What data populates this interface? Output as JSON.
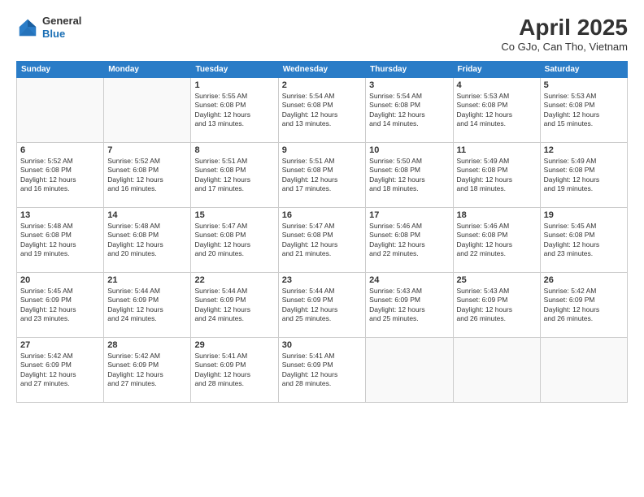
{
  "header": {
    "logo_general": "General",
    "logo_blue": "Blue",
    "month_year": "April 2025",
    "location": "Co GJo, Can Tho, Vietnam"
  },
  "days_of_week": [
    "Sunday",
    "Monday",
    "Tuesday",
    "Wednesday",
    "Thursday",
    "Friday",
    "Saturday"
  ],
  "weeks": [
    [
      {
        "day": "",
        "info": ""
      },
      {
        "day": "",
        "info": ""
      },
      {
        "day": "1",
        "info": "Sunrise: 5:55 AM\nSunset: 6:08 PM\nDaylight: 12 hours\nand 13 minutes."
      },
      {
        "day": "2",
        "info": "Sunrise: 5:54 AM\nSunset: 6:08 PM\nDaylight: 12 hours\nand 13 minutes."
      },
      {
        "day": "3",
        "info": "Sunrise: 5:54 AM\nSunset: 6:08 PM\nDaylight: 12 hours\nand 14 minutes."
      },
      {
        "day": "4",
        "info": "Sunrise: 5:53 AM\nSunset: 6:08 PM\nDaylight: 12 hours\nand 14 minutes."
      },
      {
        "day": "5",
        "info": "Sunrise: 5:53 AM\nSunset: 6:08 PM\nDaylight: 12 hours\nand 15 minutes."
      }
    ],
    [
      {
        "day": "6",
        "info": "Sunrise: 5:52 AM\nSunset: 6:08 PM\nDaylight: 12 hours\nand 16 minutes."
      },
      {
        "day": "7",
        "info": "Sunrise: 5:52 AM\nSunset: 6:08 PM\nDaylight: 12 hours\nand 16 minutes."
      },
      {
        "day": "8",
        "info": "Sunrise: 5:51 AM\nSunset: 6:08 PM\nDaylight: 12 hours\nand 17 minutes."
      },
      {
        "day": "9",
        "info": "Sunrise: 5:51 AM\nSunset: 6:08 PM\nDaylight: 12 hours\nand 17 minutes."
      },
      {
        "day": "10",
        "info": "Sunrise: 5:50 AM\nSunset: 6:08 PM\nDaylight: 12 hours\nand 18 minutes."
      },
      {
        "day": "11",
        "info": "Sunrise: 5:49 AM\nSunset: 6:08 PM\nDaylight: 12 hours\nand 18 minutes."
      },
      {
        "day": "12",
        "info": "Sunrise: 5:49 AM\nSunset: 6:08 PM\nDaylight: 12 hours\nand 19 minutes."
      }
    ],
    [
      {
        "day": "13",
        "info": "Sunrise: 5:48 AM\nSunset: 6:08 PM\nDaylight: 12 hours\nand 19 minutes."
      },
      {
        "day": "14",
        "info": "Sunrise: 5:48 AM\nSunset: 6:08 PM\nDaylight: 12 hours\nand 20 minutes."
      },
      {
        "day": "15",
        "info": "Sunrise: 5:47 AM\nSunset: 6:08 PM\nDaylight: 12 hours\nand 20 minutes."
      },
      {
        "day": "16",
        "info": "Sunrise: 5:47 AM\nSunset: 6:08 PM\nDaylight: 12 hours\nand 21 minutes."
      },
      {
        "day": "17",
        "info": "Sunrise: 5:46 AM\nSunset: 6:08 PM\nDaylight: 12 hours\nand 22 minutes."
      },
      {
        "day": "18",
        "info": "Sunrise: 5:46 AM\nSunset: 6:08 PM\nDaylight: 12 hours\nand 22 minutes."
      },
      {
        "day": "19",
        "info": "Sunrise: 5:45 AM\nSunset: 6:08 PM\nDaylight: 12 hours\nand 23 minutes."
      }
    ],
    [
      {
        "day": "20",
        "info": "Sunrise: 5:45 AM\nSunset: 6:09 PM\nDaylight: 12 hours\nand 23 minutes."
      },
      {
        "day": "21",
        "info": "Sunrise: 5:44 AM\nSunset: 6:09 PM\nDaylight: 12 hours\nand 24 minutes."
      },
      {
        "day": "22",
        "info": "Sunrise: 5:44 AM\nSunset: 6:09 PM\nDaylight: 12 hours\nand 24 minutes."
      },
      {
        "day": "23",
        "info": "Sunrise: 5:44 AM\nSunset: 6:09 PM\nDaylight: 12 hours\nand 25 minutes."
      },
      {
        "day": "24",
        "info": "Sunrise: 5:43 AM\nSunset: 6:09 PM\nDaylight: 12 hours\nand 25 minutes."
      },
      {
        "day": "25",
        "info": "Sunrise: 5:43 AM\nSunset: 6:09 PM\nDaylight: 12 hours\nand 26 minutes."
      },
      {
        "day": "26",
        "info": "Sunrise: 5:42 AM\nSunset: 6:09 PM\nDaylight: 12 hours\nand 26 minutes."
      }
    ],
    [
      {
        "day": "27",
        "info": "Sunrise: 5:42 AM\nSunset: 6:09 PM\nDaylight: 12 hours\nand 27 minutes."
      },
      {
        "day": "28",
        "info": "Sunrise: 5:42 AM\nSunset: 6:09 PM\nDaylight: 12 hours\nand 27 minutes."
      },
      {
        "day": "29",
        "info": "Sunrise: 5:41 AM\nSunset: 6:09 PM\nDaylight: 12 hours\nand 28 minutes."
      },
      {
        "day": "30",
        "info": "Sunrise: 5:41 AM\nSunset: 6:09 PM\nDaylight: 12 hours\nand 28 minutes."
      },
      {
        "day": "",
        "info": ""
      },
      {
        "day": "",
        "info": ""
      },
      {
        "day": "",
        "info": ""
      }
    ]
  ]
}
